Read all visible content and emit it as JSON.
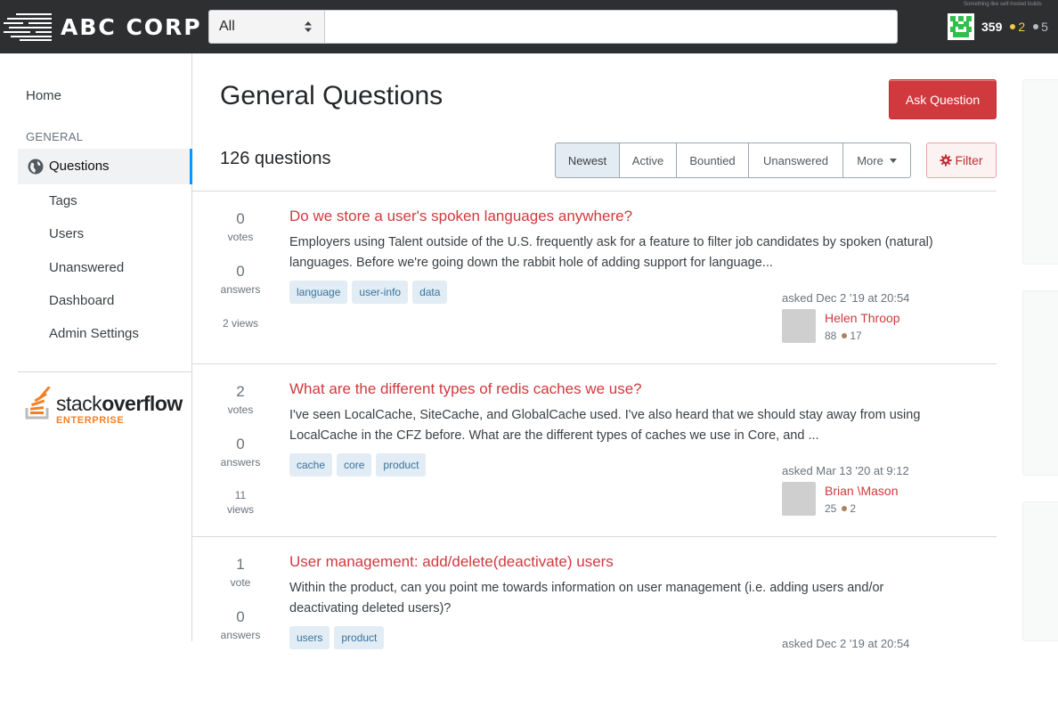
{
  "header": {
    "brand": "ABC CORP",
    "scope_select": "All",
    "search_value": "",
    "reputation": "359",
    "gold_badges": "2",
    "silver_badges": "5",
    "tiny_note": "Something like self-hosted builds",
    "colors": {
      "bar": "#2d2f31",
      "gold": "#f2c94c",
      "silver": "#b6bbbf"
    }
  },
  "sidebar": {
    "home": "Home",
    "section": "GENERAL",
    "questions": "Questions",
    "items": [
      "Tags",
      "Users",
      "Unanswered",
      "Dashboard",
      "Admin Settings"
    ],
    "logo_word_light": "stack",
    "logo_word_bold": "overflow",
    "logo_sub": "ENTERPRISE"
  },
  "main": {
    "title": "General Questions",
    "ask_button": "Ask Question",
    "count_text": "126 questions",
    "sort_tabs": [
      "Newest",
      "Active",
      "Bountied",
      "Unanswered",
      "More"
    ],
    "active_tab": "Newest",
    "filter_button": "Filter"
  },
  "questions": [
    {
      "votes": "0",
      "votes_label": "votes",
      "answers": "0",
      "answers_label": "answers",
      "views": "2 views",
      "title": "Do we store a user's spoken languages anywhere?",
      "excerpt": "Employers using Talent outside of the U.S. frequently ask for a feature to filter job candidates by spoken (natural) languages. Before we're going down the rabbit hole of adding support for language...",
      "tags": [
        "language",
        "user-info",
        "data"
      ],
      "asked": "asked Dec 2 '19 at 20:54",
      "user": "Helen Throop",
      "rep": "88",
      "bronze": "17"
    },
    {
      "votes": "2",
      "votes_label": "votes",
      "answers": "0",
      "answers_label": "answers",
      "views_num": "11",
      "views_label": "views",
      "title": "What are the different types of redis caches we use?",
      "excerpt": "I've seen LocalCache, SiteCache, and GlobalCache used. I've also heard that we should stay away from using LocalCache in the CFZ before. What are the different types of caches we use in Core, and ...",
      "tags": [
        "cache",
        "core",
        "product"
      ],
      "asked": "asked Mar 13 '20 at 9:12",
      "user": "Brian \\Mason",
      "rep": "25",
      "bronze": "2"
    },
    {
      "votes": "1",
      "votes_label": "vote",
      "answers": "0",
      "answers_label": "answers",
      "title": "User management: add/delete(deactivate) users",
      "excerpt": "Within the product, can you point me towards information on user management (i.e. adding users and/or deactivating deleted users)?",
      "tags": [
        "users",
        "product"
      ],
      "asked": "asked Dec 2 '19 at 20:54"
    }
  ]
}
